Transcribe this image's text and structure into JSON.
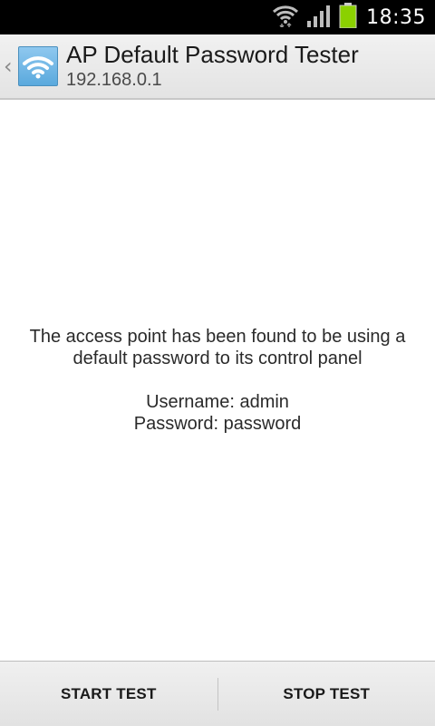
{
  "status_bar": {
    "time": "18:35",
    "icons": [
      "wifi-icon",
      "signal-icon",
      "battery-icon"
    ],
    "battery_color": "#8bd100"
  },
  "action_bar": {
    "title": "AP Default Password Tester",
    "subtitle": "192.168.0.1",
    "up_indicator": "‹",
    "app_icon": "wifi-icon"
  },
  "content": {
    "message": "The access point has been found to be using a default password to its control panel",
    "username_line": "Username: admin",
    "password_line": "Password: password"
  },
  "buttons": {
    "start": "START TEST",
    "stop": "STOP TEST"
  }
}
